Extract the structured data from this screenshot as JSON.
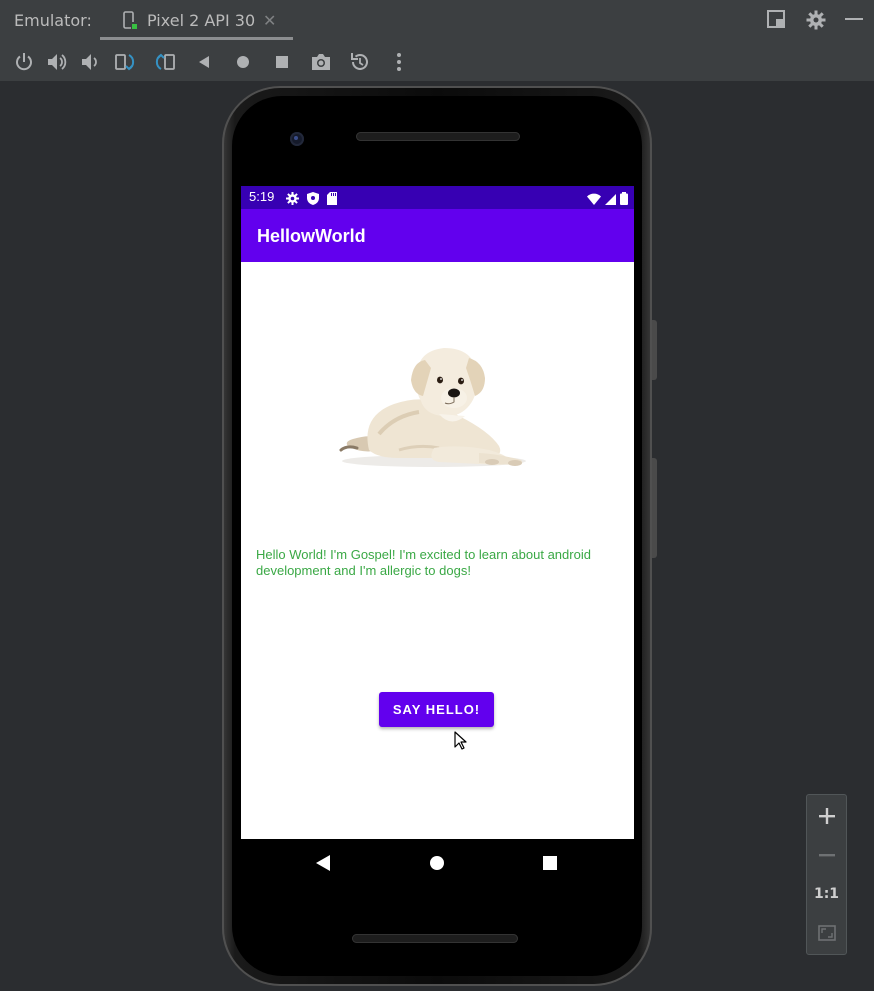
{
  "ide": {
    "emulator_label": "Emulator:",
    "tab_title": "Pixel 2 API 30",
    "tab_close": "✕"
  },
  "toolbar": {
    "items": [
      "power-icon",
      "volume-up-icon",
      "volume-down-icon",
      "rotate-left-icon",
      "rotate-right-icon",
      "back-icon",
      "home-icon",
      "overview-icon",
      "screenshot-icon",
      "snapshot-icon",
      "more-icon"
    ]
  },
  "device": {
    "status": {
      "time": "5:19"
    },
    "app": {
      "title": "HellowWorld",
      "message": "Hello World! I'm Gospel! I'm excited to learn about android development and I'm allergic to dogs!",
      "button_label": "SAY HELLO!"
    }
  },
  "zoom": {
    "one_to_one": "1:1"
  },
  "colors": {
    "status_bar": "#3700b3",
    "app_bar": "#6200ee",
    "message_text": "#3aa845",
    "ide_background": "#2b2d30",
    "ide_toolbar": "#3c3f41"
  }
}
